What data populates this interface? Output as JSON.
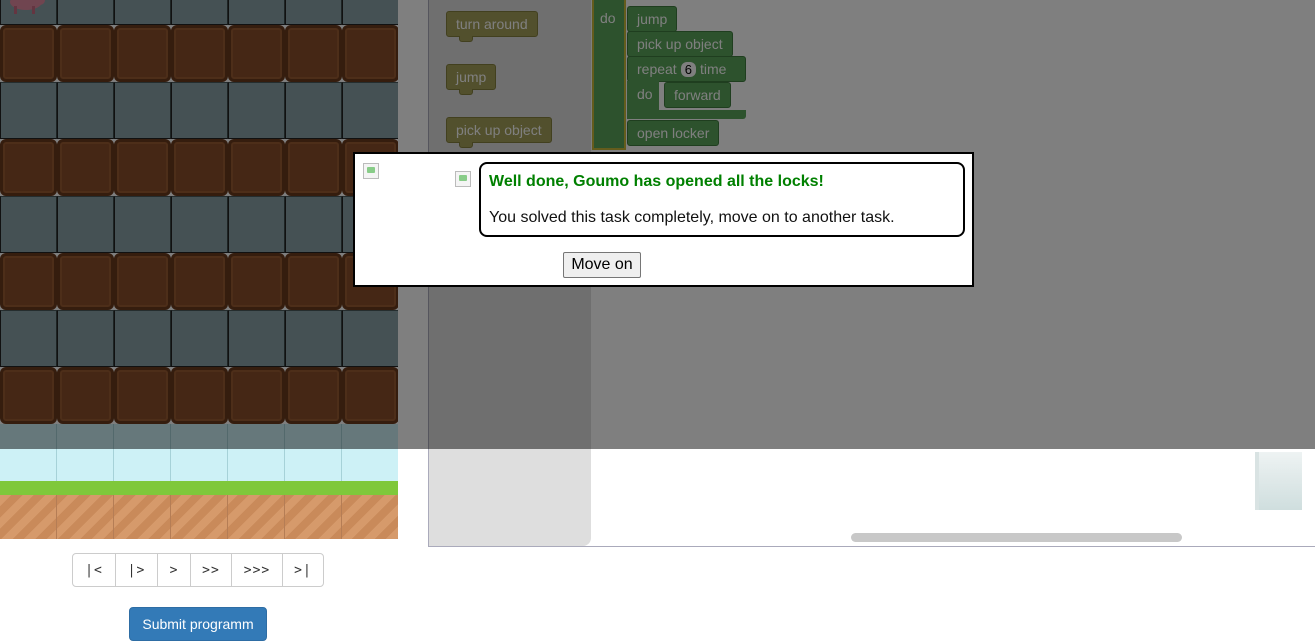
{
  "palette": {
    "block_green": "#5ba55b",
    "block_olive": "#a5a05a",
    "submit_blue": "#337ab7",
    "success_green": "#008000",
    "overlay": "rgba(0,0,0,0.5)"
  },
  "step_controls": [
    "|<",
    "|>",
    ">",
    ">>",
    ">>>",
    ">|"
  ],
  "submit_label": "Submit programm",
  "flyout_blocks": [
    "turn around",
    "jump",
    "pick up object"
  ],
  "program": {
    "do_keyword": "do",
    "block_jump": "jump",
    "block_pick_up": "pick up object",
    "repeat_label": "repeat",
    "repeat_count": "6",
    "repeat_unit": "time",
    "inner_do_keyword": "do",
    "inner_block": "forward",
    "block_open_locker": "open locker"
  },
  "dialog": {
    "title": "Well done, Goumo has opened all the locks!",
    "message": "You solved this task completely, move on to another task.",
    "button": "Move on"
  }
}
